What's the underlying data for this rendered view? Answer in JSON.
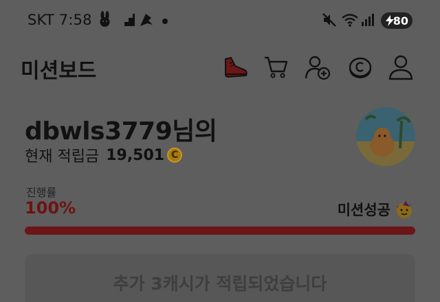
{
  "status_bar": {
    "carrier_time": "SKT 7:58",
    "battery": "80",
    "icons": [
      "rabbit-icon",
      "stairs-icon",
      "notification-app-icon",
      "mute-icon",
      "wifi-icon",
      "signal-icon",
      "battery-icon"
    ]
  },
  "header": {
    "title": "미션보드",
    "icons": [
      "sneaker-icon",
      "cart-icon",
      "add-friend-icon",
      "coin-icon",
      "profile-icon"
    ]
  },
  "user": {
    "name": "dbwls3779님의",
    "points_label": "현재 적립금",
    "points_value": "19,501",
    "coin_symbol": "C"
  },
  "progress": {
    "label": "진행률",
    "value": "100%",
    "fraction": 1.0,
    "status": "미션성공"
  },
  "bonus_button": {
    "label": "추가 3캐시가 적립되었습니다"
  },
  "colors": {
    "overlay_bg": "#5e5e5e",
    "accent": "#6c1618",
    "coin": "#a57a12"
  }
}
